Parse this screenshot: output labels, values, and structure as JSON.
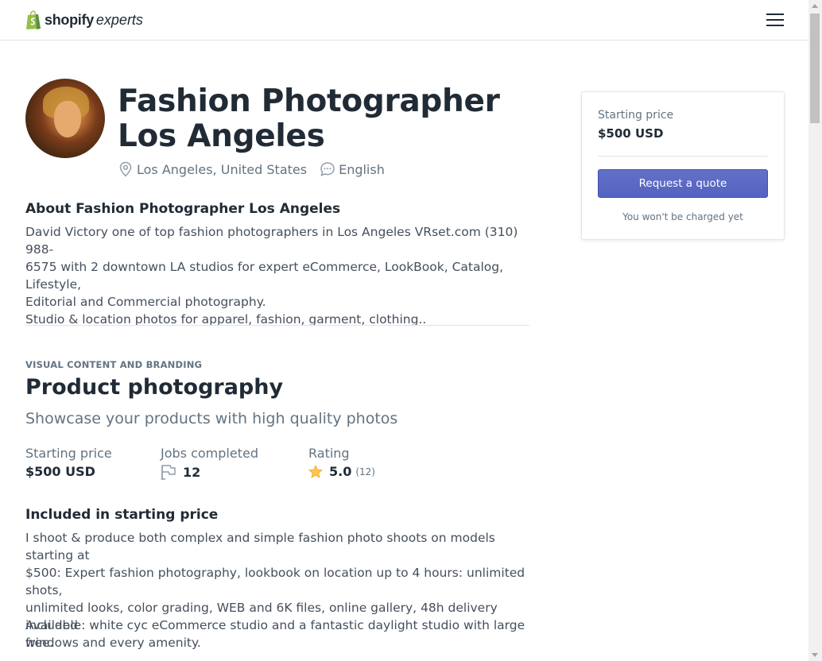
{
  "header": {
    "logo_word": "shopify",
    "logo_suffix": "experts",
    "menu_icon": "hamburger-icon"
  },
  "profile": {
    "name": "Fashion Photographer Los Angeles",
    "location": "Los Angeles, United States",
    "language": "English",
    "location_icon": "map-pin-icon",
    "language_icon": "chat-bubble-icon"
  },
  "about": {
    "heading": "About Fashion Photographer Los Angeles",
    "line1": "David Victory one of top fashion photographers in Los Angeles VRset.com (310) 988-",
    "line2": "6575 with 2 downtown LA studios for expert eCommerce, LookBook, Catalog, Lifestyle,",
    "line3": "Editorial and Commercial photography.",
    "line4": "Studio & location photos for apparel, fashion, garment, clothing.."
  },
  "service": {
    "category": "VISUAL CONTENT AND BRANDING",
    "title": "Product photography",
    "subtitle": "Showcase your products with high quality photos",
    "stats": {
      "starting_price_label": "Starting price",
      "starting_price_value": "$500 USD",
      "jobs_label": "Jobs completed",
      "jobs_value": "12",
      "rating_label": "Rating",
      "rating_value": "5.0",
      "rating_count": "(12)",
      "star_color": "#ffc453"
    },
    "included": {
      "heading": "Included in starting price",
      "line1": "I shoot & produce both complex and simple fashion photo shoots on models starting at",
      "line2": "$500: Expert fashion photography, lookbook on location up to 4 hours: unlimited shots,",
      "line3": "unlimited looks, color grading, WEB and 6K files, online gallery, 48h delivery included",
      "line4": "free.",
      "line5": "Available: white cyc eCommerce studio and a fantastic daylight studio with large",
      "line6": "windows and every amenity."
    }
  },
  "quote_card": {
    "label": "Starting price",
    "price": "$500 USD",
    "button": "Request a quote",
    "note": "You won't be charged yet",
    "button_color": "#5c6ac4"
  }
}
